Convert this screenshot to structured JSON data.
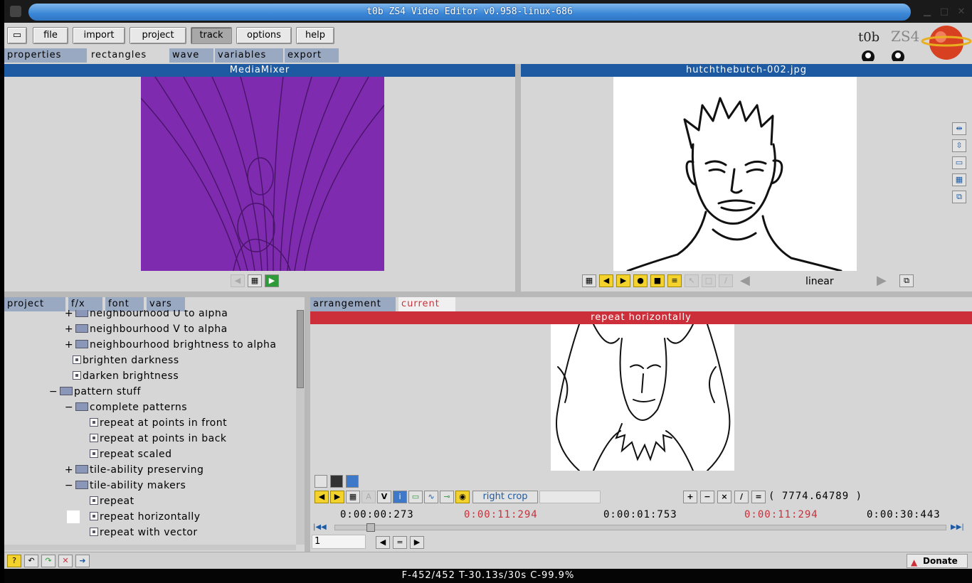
{
  "window": {
    "title": "t0b ZS4 Video Editor v0.958-linux-686"
  },
  "menu": [
    "file",
    "import",
    "project",
    "track",
    "options",
    "help"
  ],
  "top_tabs": [
    "properties",
    "rectangles",
    "wave",
    "variables",
    "export"
  ],
  "panels": {
    "left_viewer_title": "MediaMixer",
    "right_viewer_title": "hutchthebutch-002.jpg",
    "interpolation": "linear",
    "tools_tabs": [
      "project",
      "f/x",
      "font",
      "vars"
    ],
    "work_tabs": [
      "arrangement",
      "current"
    ],
    "effect_title": "repeat horizontally"
  },
  "tree": [
    {
      "indent": 1,
      "kind": "folder",
      "expander": "+",
      "label": "neighbourhood U to alpha"
    },
    {
      "indent": 1,
      "kind": "folder",
      "expander": "+",
      "label": "neighbourhood V to alpha"
    },
    {
      "indent": 1,
      "kind": "folder",
      "expander": "+",
      "label": "neighbourhood brightness to alpha"
    },
    {
      "indent": 1,
      "kind": "leaf",
      "expander": "",
      "label": "brighten darkness"
    },
    {
      "indent": 1,
      "kind": "leaf",
      "expander": "",
      "label": "darken brightness"
    },
    {
      "indent": 0,
      "kind": "folder",
      "expander": "−",
      "label": "pattern stuff"
    },
    {
      "indent": 1,
      "kind": "folder",
      "expander": "−",
      "label": "complete patterns"
    },
    {
      "indent": 2,
      "kind": "leaf",
      "expander": "",
      "label": "repeat at points in front"
    },
    {
      "indent": 2,
      "kind": "leaf",
      "expander": "",
      "label": "repeat at points in back"
    },
    {
      "indent": 2,
      "kind": "leaf",
      "expander": "",
      "label": "repeat scaled"
    },
    {
      "indent": 1,
      "kind": "folder",
      "expander": "+",
      "label": "tile-ability preserving"
    },
    {
      "indent": 1,
      "kind": "folder",
      "expander": "−",
      "label": "tile-ability makers"
    },
    {
      "indent": 2,
      "kind": "leaf",
      "expander": "",
      "label": "repeat"
    },
    {
      "indent": 2,
      "kind": "leaf",
      "expander": "",
      "label": "repeat horizontally"
    },
    {
      "indent": 2,
      "kind": "leaf",
      "expander": "",
      "label": "repeat with vector"
    }
  ],
  "editor": {
    "crop_button": "right crop",
    "value": "( 7774.64789 )",
    "times": [
      "0:00:00:273",
      "0:00:11:294",
      "0:00:01:753",
      "0:00:11:294",
      "0:00:30:443"
    ],
    "time_colors": [
      "#000000",
      "#cc2f3a",
      "#000000",
      "#cc2f3a",
      "#000000"
    ],
    "frame_field": "1"
  },
  "donate_label": "Donate",
  "status": "F-452/452 T-30.13s/30s C-99.9%",
  "colors": {
    "viewer_purple": "#7f2bb0",
    "header_blue": "#1d5aa2",
    "header_red": "#cc2f3a"
  }
}
